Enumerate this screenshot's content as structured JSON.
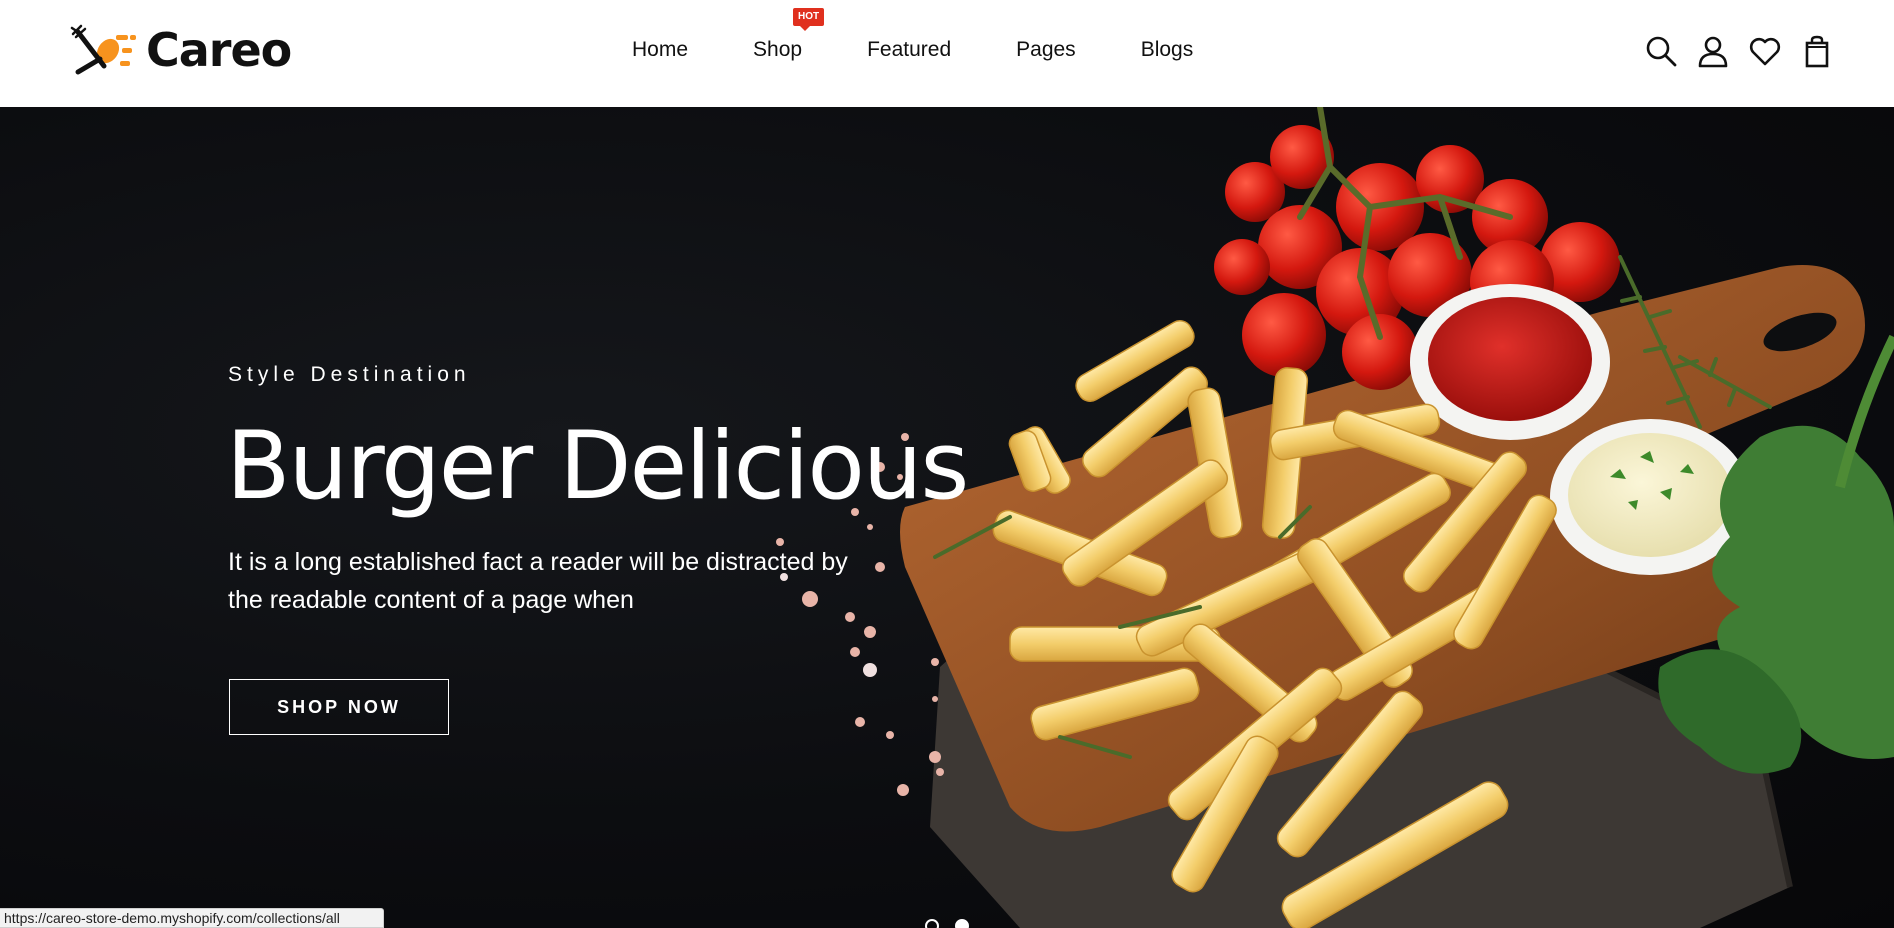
{
  "brand": {
    "name": "Careo",
    "accent_color": "#f7931e"
  },
  "nav": {
    "items": [
      {
        "label": "Home"
      },
      {
        "label": "Shop",
        "badge": "HOT"
      },
      {
        "label": "Featured"
      },
      {
        "label": "Pages"
      },
      {
        "label": "Blogs"
      }
    ],
    "badge_color": "#e0301e"
  },
  "header_icons": [
    "search-icon",
    "account-icon",
    "wishlist-heart-icon",
    "shopping-bag-icon"
  ],
  "hero": {
    "eyebrow": "Style Destination",
    "title": "Burger Delicious",
    "description": "It is a long established fact a reader will be distracted by the readable content of a page when",
    "button_label": "SHOP NOW",
    "slides": {
      "count": 2,
      "active": 2
    }
  },
  "status_bar": {
    "url": "https://careo-store-demo.myshopify.com/collections/all"
  }
}
